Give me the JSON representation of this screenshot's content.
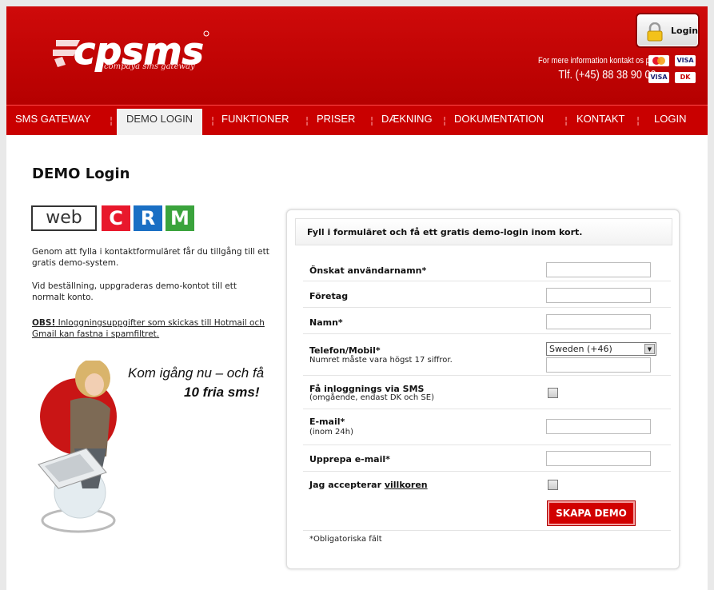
{
  "header": {
    "logo_tagline": "compaya sms gateway",
    "login_label": "Login",
    "contact_line1": "For mere information kontakt os på:",
    "contact_phone": "Tlf. (+45) 88 38 90 00",
    "card_visa": "VISA",
    "card_dk": "DK"
  },
  "nav": {
    "items": [
      "SMS GATEWAY",
      "DEMO LOGIN",
      "FUNKTIONER",
      "PRISER",
      "DÆKNING",
      "DOKUMENTATION",
      "KONTAKT",
      "LOGIN"
    ],
    "separator": "¦"
  },
  "main": {
    "title": "DEMO Login",
    "webcrm": {
      "web": "web",
      "c": "C",
      "r": "R",
      "m": "M"
    },
    "para1": "Genom att fylla i kontaktformuläret får du tillgång till ett gratis demo-system.",
    "para2": "Vid beställning, uppgraderas demo-kontot till ett normalt konto.",
    "obs_label": "OBS!",
    "obs_text": " Inloggningsuppgifter som skickas till Hotmail och Gmail kan fastna i spamfiltret.",
    "promo_line1": "Kom igång nu – och få",
    "promo_line2": "10 fria sms!"
  },
  "form": {
    "heading": "Fyll i formuläret och få ett gratis demo-login inom kort.",
    "username_label": "Önskat användarnamn*",
    "company_label": "Företag",
    "name_label": "Namn*",
    "phone_label": "Telefon/Mobil*",
    "phone_sub": "Numret måste vara högst 17 siffror.",
    "country_value": "Sweden (+46)",
    "sms_label": "Få inloggnings via SMS",
    "sms_sub": "(omgående, endast DK och SE)",
    "email_label": "E-mail*",
    "email_sub": "(inom 24h)",
    "email_repeat_label": "Upprepa e-mail*",
    "terms_label": "Jag accepterar ",
    "terms_link": "villkoren",
    "submit_label": "SKAPA DEMO",
    "required_note": "*Obligatoriska fält"
  },
  "colors": {
    "brand_red": "#c90000",
    "crm_c": "#e8182c",
    "crm_r": "#1a6fc4",
    "crm_m": "#3aa33c"
  }
}
